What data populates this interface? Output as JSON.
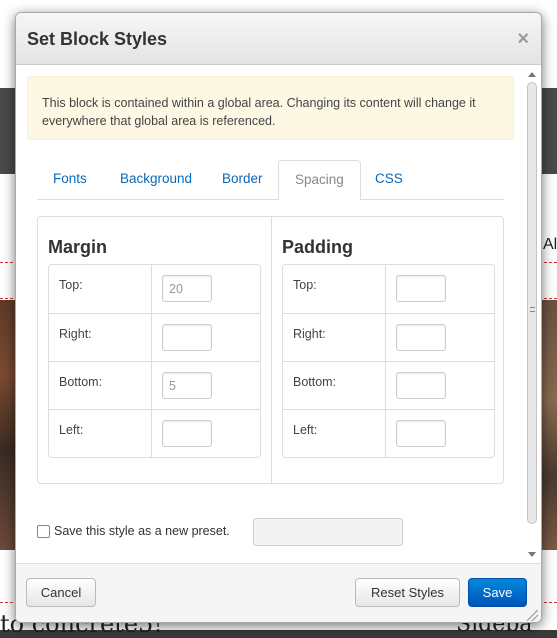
{
  "background": {
    "bottom_text": "to concrete5!",
    "bottom_right_text": "Sideba",
    "side_char": "Al"
  },
  "dialog": {
    "title": "Set Block Styles",
    "close_glyph": "×",
    "alert": "This block is contained within a global area. Changing its content will change it everywhere that global area is referenced.",
    "tabs": [
      {
        "label": "Fonts",
        "active": false
      },
      {
        "label": "Background",
        "active": false
      },
      {
        "label": "Border",
        "active": false
      },
      {
        "label": "Spacing",
        "active": true
      },
      {
        "label": "CSS",
        "active": false
      }
    ],
    "margin": {
      "title": "Margin",
      "rows": [
        {
          "label": "Top:",
          "value": "20"
        },
        {
          "label": "Right:",
          "value": ""
        },
        {
          "label": "Bottom:",
          "value": "5"
        },
        {
          "label": "Left:",
          "value": ""
        }
      ]
    },
    "padding": {
      "title": "Padding",
      "rows": [
        {
          "label": "Top:",
          "value": ""
        },
        {
          "label": "Right:",
          "value": ""
        },
        {
          "label": "Bottom:",
          "value": ""
        },
        {
          "label": "Left:",
          "value": ""
        }
      ]
    },
    "preset": {
      "label": "Save this style as a new preset.",
      "checked": false,
      "name_value": ""
    },
    "footer": {
      "cancel_label": "Cancel",
      "reset_label": "Reset Styles",
      "save_label": "Save"
    }
  },
  "colors": {
    "link": "#0869b8",
    "primary_button": "#0066cc",
    "alert_bg": "#fcf8e3"
  }
}
